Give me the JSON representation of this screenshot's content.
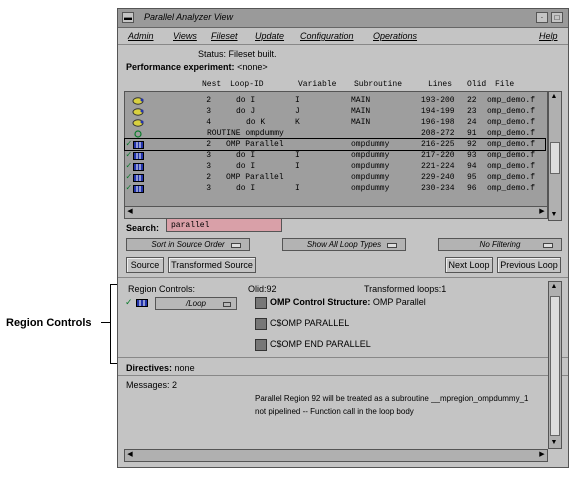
{
  "callout": {
    "label": "Region Controls"
  },
  "window": {
    "title": "Parallel Analyzer View",
    "menu": [
      "Admin",
      "Views",
      "Fileset",
      "Update",
      "Configuration",
      "Operations"
    ],
    "help": "Help",
    "status_label": "Status:",
    "status_value": "Fileset built.",
    "perf_label": "Performance experiment:",
    "perf_value": "<none>"
  },
  "columns": [
    "Nest",
    "Loop-ID",
    "Variable",
    "Subroutine",
    "Lines",
    "Olid",
    "File"
  ],
  "rows": [
    {
      "nest": "2",
      "loop": "do I",
      "var": "I",
      "sub": "MAIN",
      "lines": "193-200",
      "olid": "22",
      "file": "omp_demo.f",
      "icon": "loop-yellow",
      "check": false
    },
    {
      "nest": "3",
      "loop": "do J",
      "var": "J",
      "sub": "MAIN",
      "lines": "194-199",
      "olid": "23",
      "file": "omp_demo.f",
      "icon": "loop-yellow",
      "check": false
    },
    {
      "nest": "4",
      "loop": "do K",
      "var": "K",
      "sub": "MAIN",
      "lines": "196-198",
      "olid": "24",
      "file": "omp_demo.f",
      "icon": "loop-yellow",
      "check": false
    },
    {
      "nest": "",
      "loop": "ROUTINE ompdummy",
      "var": "",
      "sub": "",
      "lines": "208-272",
      "olid": "91",
      "file": "omp_demo.f",
      "icon": "routine-circle",
      "check": false
    },
    {
      "nest": "2",
      "loop": "OMP Parallel",
      "var": "",
      "sub": "ompdummy",
      "lines": "216-225",
      "olid": "92",
      "file": "omp_demo.f",
      "icon": "parallel-blue",
      "check": true
    },
    {
      "nest": "3",
      "loop": "do I",
      "var": "I",
      "sub": "ompdummy",
      "lines": "217-220",
      "olid": "93",
      "file": "omp_demo.f",
      "icon": "parallel-blue",
      "check": true
    },
    {
      "nest": "3",
      "loop": "do I",
      "var": "I",
      "sub": "ompdummy",
      "lines": "221-224",
      "olid": "94",
      "file": "omp_demo.f",
      "icon": "parallel-blue",
      "check": true
    },
    {
      "nest": "2",
      "loop": "OMP Parallel",
      "var": "",
      "sub": "ompdummy",
      "lines": "229-240",
      "olid": "95",
      "file": "omp_demo.f",
      "icon": "parallel-blue",
      "check": true
    },
    {
      "nest": "3",
      "loop": "do I",
      "var": "I",
      "sub": "ompdummy",
      "lines": "230-234",
      "olid": "96",
      "file": "omp_demo.f",
      "icon": "parallel-blue",
      "check": true
    }
  ],
  "search": {
    "label": "Search:",
    "value": "parallel"
  },
  "options": {
    "sort": "Sort in Source Order",
    "types": "Show All Loop Types",
    "filter": "No Filtering"
  },
  "buttons": {
    "source": "Source",
    "transformed": "Transformed Source",
    "next": "Next Loop",
    "previous": "Previous Loop"
  },
  "region": {
    "controls_label": "Region Controls:",
    "olid": "Olid:92",
    "transformed_loops": "Transformed loops:1",
    "loop_option": "/Loop",
    "structure_label": "OMP Control Structure:",
    "structure_value": "OMP Parallel",
    "directive1": "C$OMP PARALLEL",
    "directive2": "C$OMP END PARALLEL"
  },
  "directives": {
    "label": "Directives:",
    "value": "none"
  },
  "messages": {
    "label": "Messages: 2",
    "line1": "Parallel Region 92 will be treated as a subroutine __mpregion_ompdummy_1",
    "line2": "not pipelined -- Function call in the loop body"
  },
  "colors": {
    "window_bg": "#c4c4c4",
    "list_bg": "#9e9e9e",
    "search_bg": "#d9a0a8",
    "check": "#0a7a2b",
    "loop_icon": "#d8d040",
    "parallel_icon": "#2233aa"
  }
}
